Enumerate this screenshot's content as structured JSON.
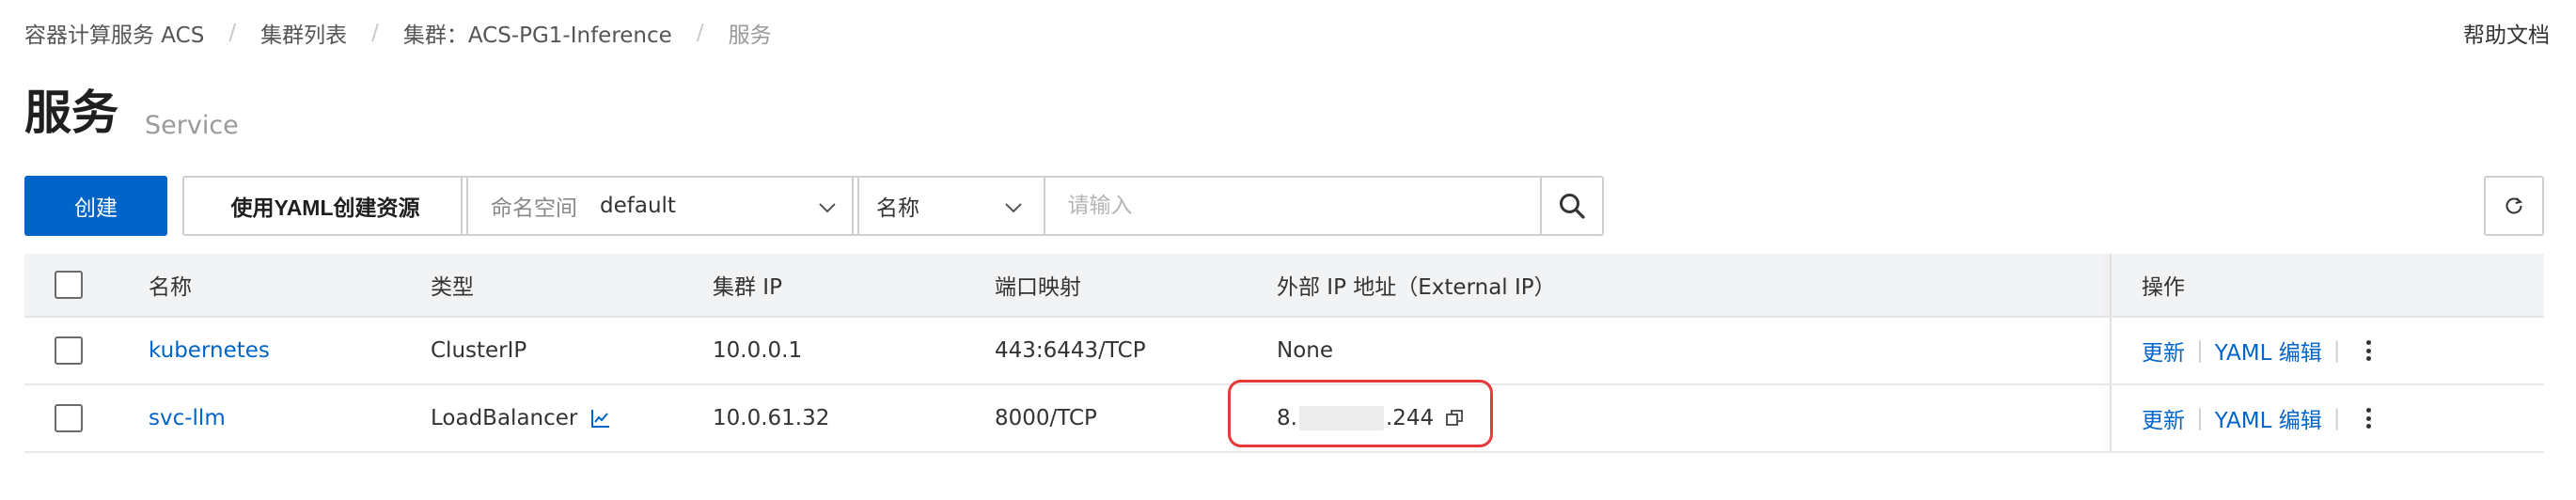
{
  "breadcrumb": {
    "items": [
      "容器计算服务 ACS",
      "集群列表",
      "集群：ACS-PG1-Inference"
    ],
    "current": "服务",
    "separator": "/"
  },
  "help_link": "帮助文档",
  "page": {
    "title": "服务",
    "subtitle": "Service"
  },
  "toolbar": {
    "create_label": "创建",
    "yaml_create_label": "使用YAML创建资源",
    "namespace_label": "命名空间",
    "namespace_value": "default",
    "search_field": "名称",
    "search_placeholder": "请输入"
  },
  "table": {
    "columns": {
      "name": "名称",
      "type": "类型",
      "cluster_ip": "集群 IP",
      "ports": "端口映射",
      "external_ip": "外部 IP 地址（External IP）",
      "ops": "操作"
    },
    "rows": [
      {
        "name": "kubernetes",
        "type": "ClusterIP",
        "cluster_ip": "10.0.0.1",
        "ports": "443:6443/TCP",
        "external_ip": "None",
        "op_update": "更新",
        "op_yaml": "YAML 编辑"
      },
      {
        "name": "svc-llm",
        "type": "LoadBalancer",
        "cluster_ip": "10.0.61.32",
        "ports": "8000/TCP",
        "external_ip_prefix": "8.",
        "external_ip_suffix": ".244",
        "op_update": "更新",
        "op_yaml": "YAML 编辑"
      }
    ]
  },
  "colors": {
    "primary": "#0064c8",
    "highlight": "#e33a3a",
    "header_bg": "#f2f3f5"
  }
}
